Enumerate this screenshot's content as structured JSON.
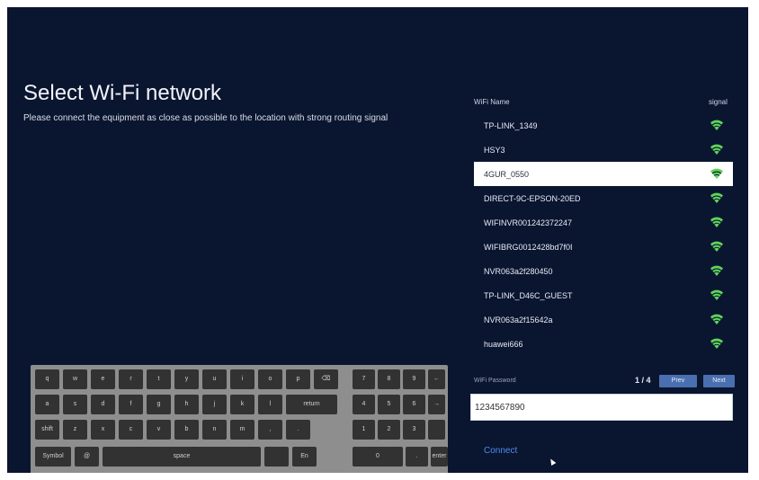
{
  "title": "Select Wi-Fi network",
  "subtitle": "Please connect the equipment as close as possible to the location with strong routing signal",
  "list_header": {
    "name": "WiFi Name",
    "signal": "signal"
  },
  "networks": [
    {
      "name": "TP-LINK_1349",
      "selected": false
    },
    {
      "name": "HSY3",
      "selected": false
    },
    {
      "name": "4GUR_0550",
      "selected": true
    },
    {
      "name": "DIRECT-9C-EPSON-20ED",
      "selected": false
    },
    {
      "name": "WIFINVR001242372247",
      "selected": false
    },
    {
      "name": "WIFIBRG0012428bd7f0I",
      "selected": false
    },
    {
      "name": "NVR063a2f280450",
      "selected": false
    },
    {
      "name": "TP-LINK_D46C_GUEST",
      "selected": false
    },
    {
      "name": "NVR063a2f15642a",
      "selected": false
    },
    {
      "name": "huawei666",
      "selected": false
    }
  ],
  "password_label": "WiFi Password",
  "password_value": "1234567890",
  "pagination": {
    "page": "1 / 4",
    "prev": "Prev",
    "next": "Next"
  },
  "connect_label": "Connect",
  "colors": {
    "background": "#0a1530",
    "signal": "#5fd35a",
    "accent": "#4f8cf2",
    "button": "#4a6fb0"
  },
  "keyboard": {
    "rows": [
      [
        "q",
        "w",
        "e",
        "r",
        "t",
        "y",
        "u",
        "i",
        "o",
        "p",
        "⌫"
      ],
      [
        "a",
        "s",
        "d",
        "f",
        "g",
        "h",
        "j",
        "k",
        "l",
        "return"
      ],
      [
        "shift",
        "z",
        "x",
        "c",
        "v",
        "b",
        "n",
        "m",
        ",",
        "."
      ],
      [
        "Symbol",
        "@",
        "space",
        "",
        "En"
      ]
    ],
    "numpad": [
      [
        "7",
        "8",
        "9",
        "←"
      ],
      [
        "4",
        "5",
        "6",
        "→"
      ],
      [
        "1",
        "2",
        "3",
        ""
      ],
      [
        "0",
        ".",
        "enter"
      ]
    ]
  }
}
